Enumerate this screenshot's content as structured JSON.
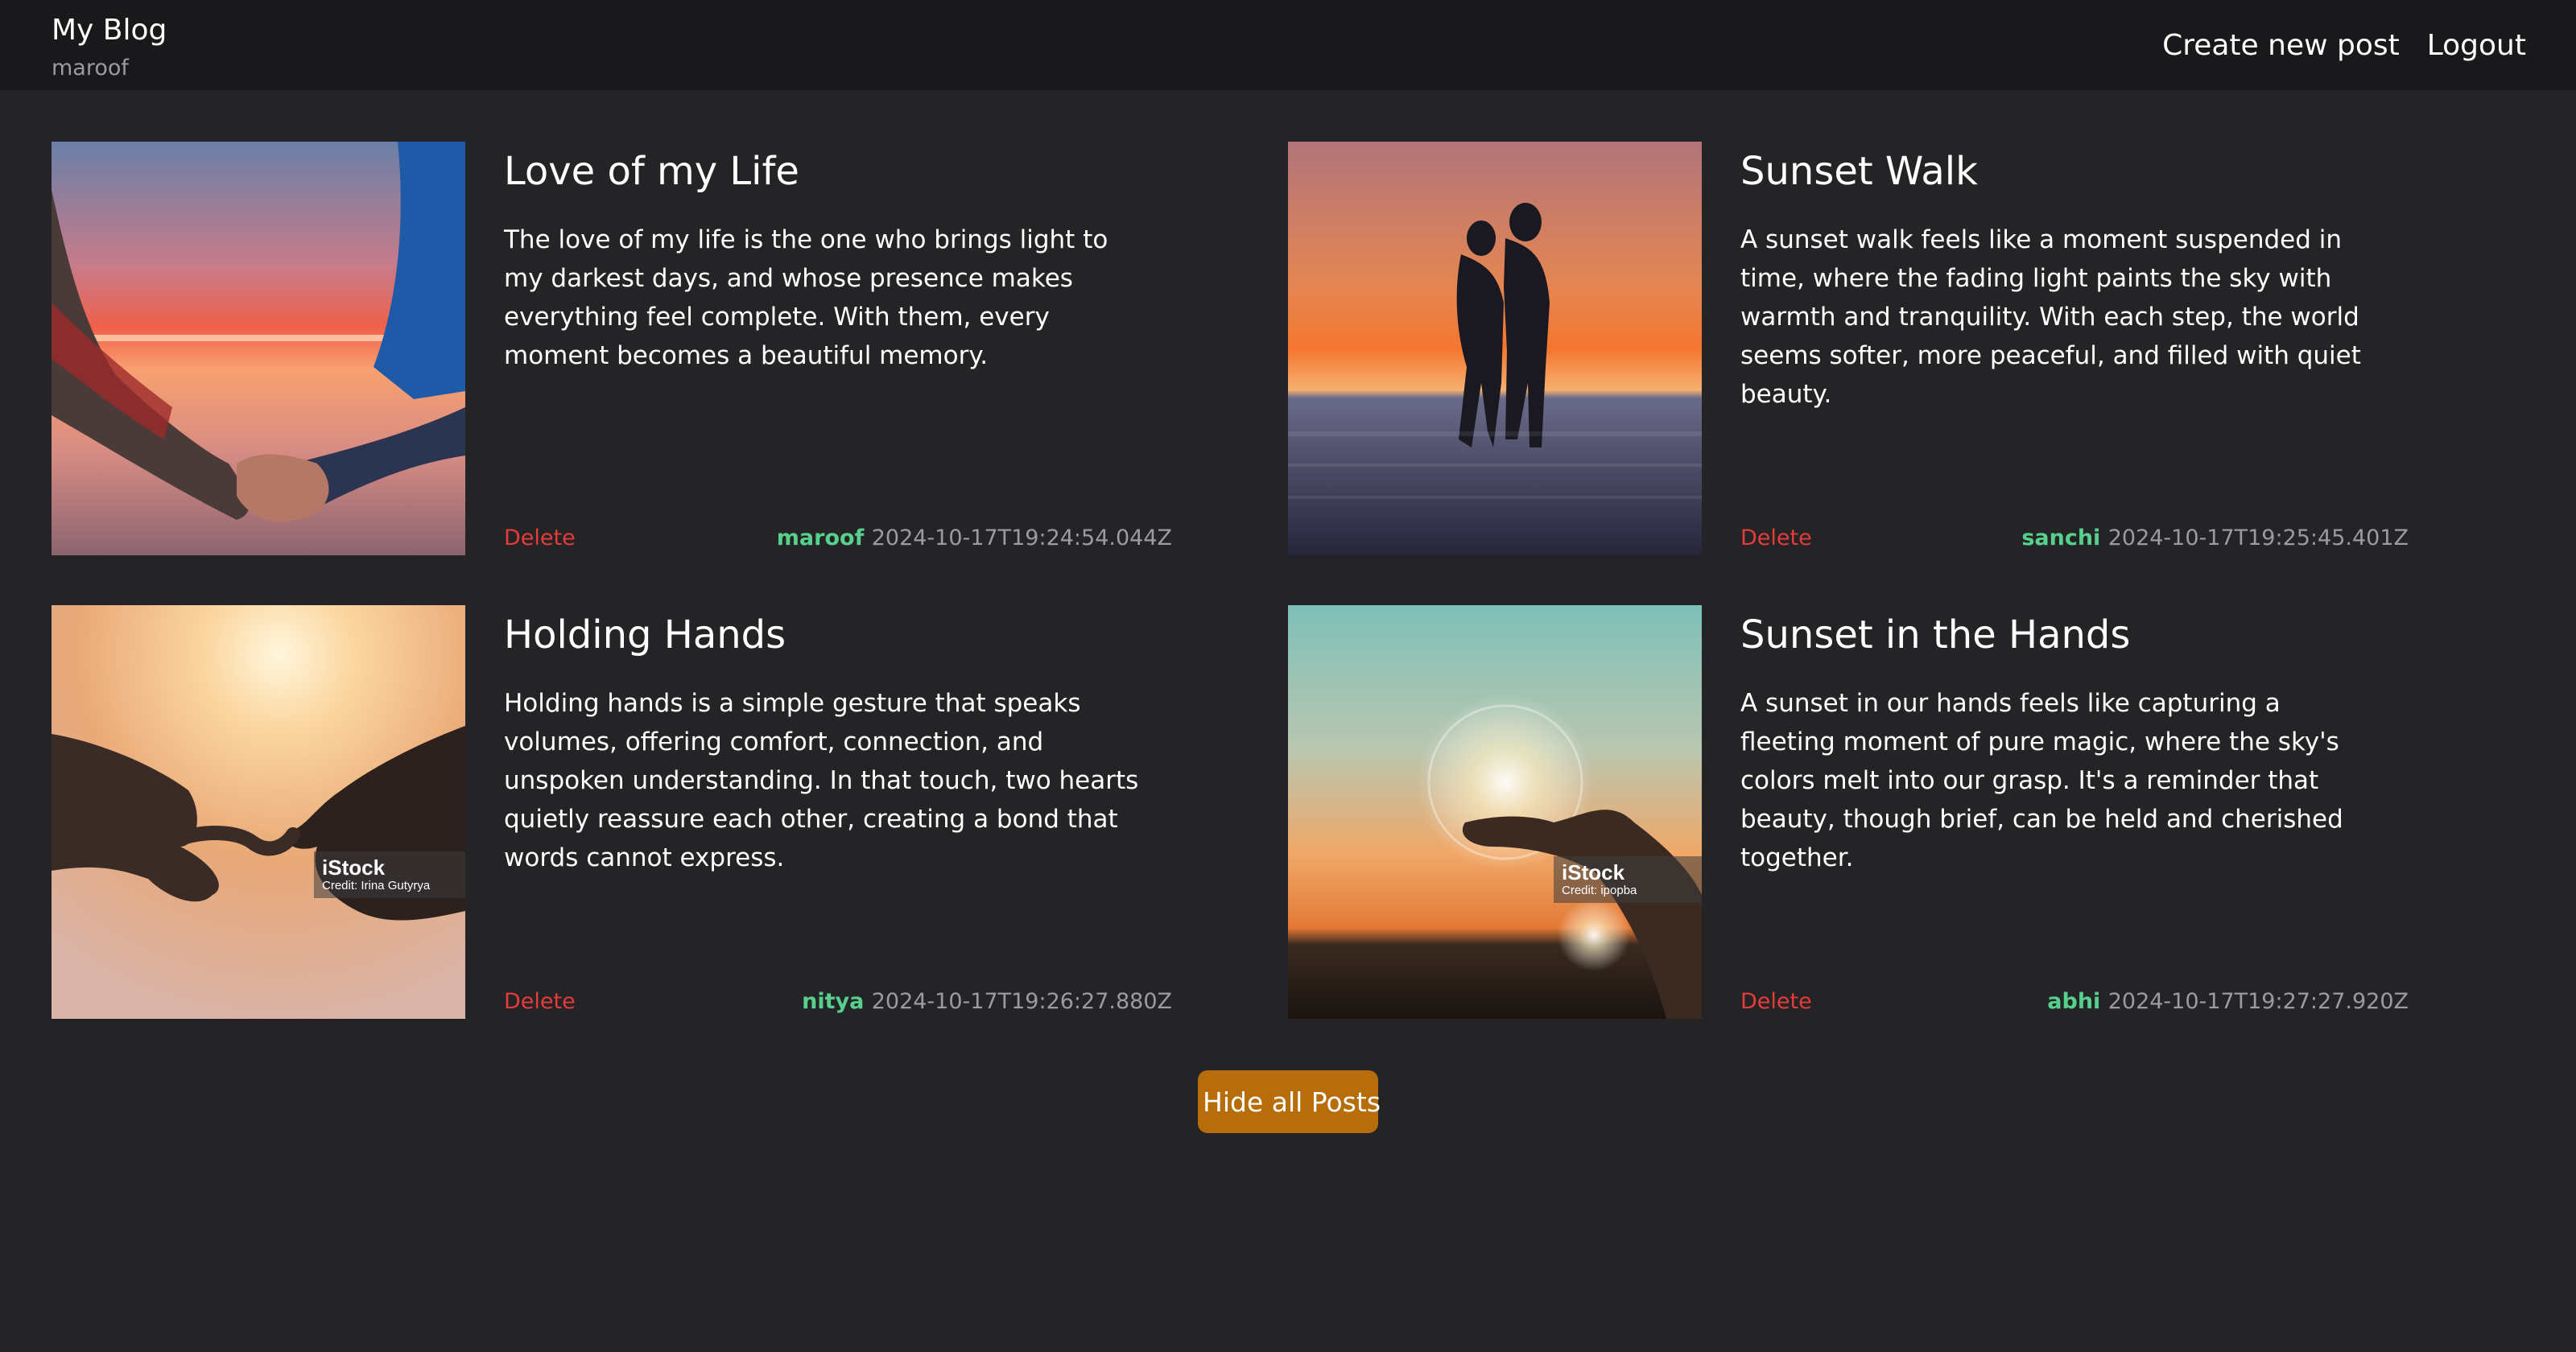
{
  "header": {
    "brand_title": "My Blog",
    "username": "maroof",
    "nav": {
      "create_label": "Create new post",
      "logout_label": "Logout"
    }
  },
  "posts": [
    {
      "title": "Love of my Life",
      "body": "The love of my life is the one who brings light to my darkest days, and whose presence makes everything feel complete. With them, every moment becomes a beautiful memory.",
      "delete_label": "Delete",
      "author": "maroof",
      "timestamp": "2024-10-17T19:24:54.044Z"
    },
    {
      "title": "Sunset Walk",
      "body": "A sunset walk feels like a moment suspended in time, where the fading light paints the sky with warmth and tranquility. With each step, the world seems softer, more peaceful, and filled with quiet beauty.",
      "delete_label": "Delete",
      "author": "sanchi",
      "timestamp": "2024-10-17T19:25:45.401Z"
    },
    {
      "title": "Holding Hands",
      "body": "Holding hands is a simple gesture that speaks volumes, offering comfort, connection, and unspoken understanding. In that touch, two hearts quietly reassure each other, creating a bond that words cannot express.",
      "delete_label": "Delete",
      "author": "nitya",
      "timestamp": "2024-10-17T19:26:27.880Z",
      "watermark": {
        "brand": "iStock",
        "credit": "Credit: Irina Gutyrya"
      }
    },
    {
      "title": "Sunset in the Hands",
      "body": "A sunset in our hands feels like capturing a fleeting moment of pure magic, where the sky's colors melt into our grasp. It's a reminder that beauty, though brief, can be held and cherished together.",
      "delete_label": "Delete",
      "author": "abhi",
      "timestamp": "2024-10-17T19:27:27.920Z",
      "watermark": {
        "brand": "iStock",
        "credit": "Credit: ipopba"
      }
    }
  ],
  "hide_button_label": "Hide all Posts",
  "colors": {
    "background": "#242427",
    "header": "#19191b",
    "author": "#57d08d",
    "delete": "#e53b3b",
    "button": "#b86d0b",
    "muted": "#9b9ba0"
  }
}
